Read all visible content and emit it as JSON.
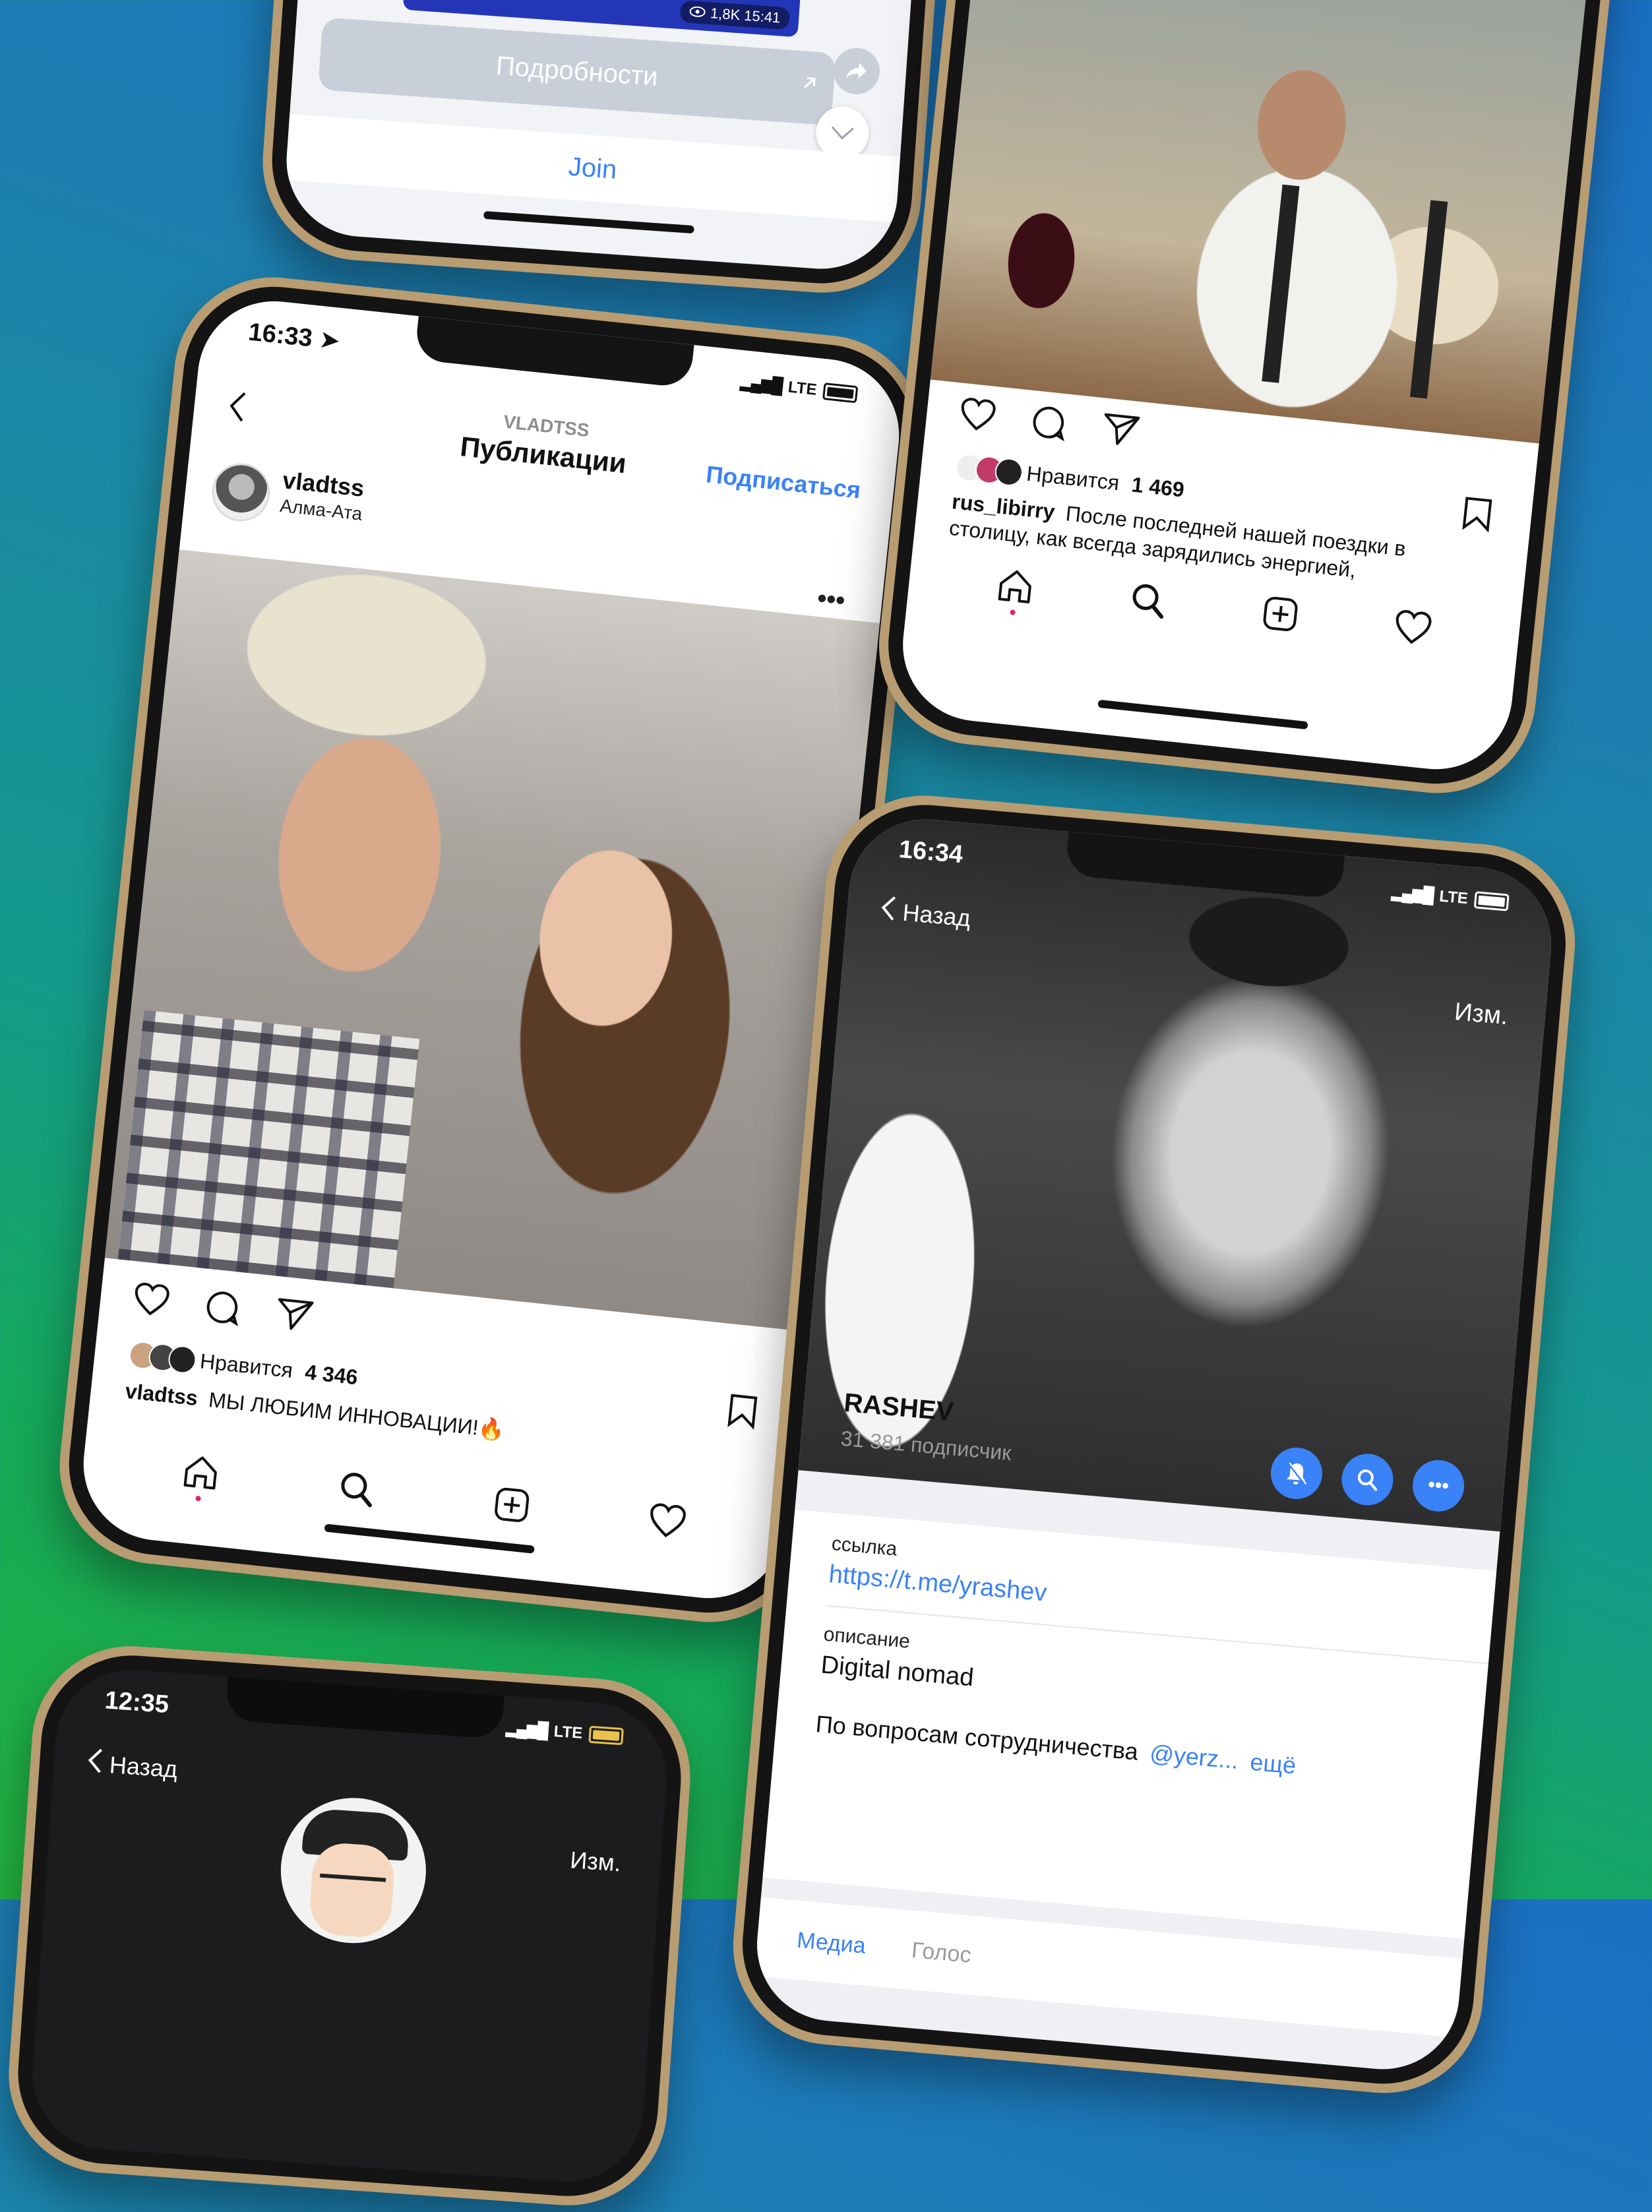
{
  "colors": {
    "accent_blue": "#3a82f7",
    "instagram_like_red": "#e0245e",
    "frame_gold": "#b89c72"
  },
  "phone_top_left": {
    "views_badge": "1,8K 15:41",
    "details_button": "Подробности",
    "join_label": "Join",
    "icons": [
      "eye-icon",
      "share-arrow-icon",
      "chevron-down-icon",
      "external-arrow-icon"
    ]
  },
  "phone_instagram_1": {
    "status": {
      "time": "16:33",
      "network": "LTE"
    },
    "header": {
      "username_upper": "VLADTSS",
      "title": "Публикации",
      "subscribe": "Подписаться"
    },
    "post": {
      "username": "vladtss",
      "location": "Алма-Ата",
      "likes_label": "Нравится",
      "likes_count": "4 346",
      "caption_user": "vladtss",
      "caption_text": "МЫ ЛЮБИМ ИННОВАЦИИ!🔥"
    },
    "icons": [
      "back-icon",
      "more-icon",
      "heart-icon",
      "comment-icon",
      "send-icon",
      "bookmark-icon",
      "home-icon",
      "search-icon",
      "add-icon",
      "activity-heart-icon"
    ]
  },
  "phone_instagram_2": {
    "post": {
      "likes_label": "Нравится",
      "likes_count": "1 469",
      "caption_user": "rus_libirry",
      "caption_text": "После последней нашей поездки в столицу, как всегда зарядились энергией,"
    },
    "icons": [
      "heart-icon",
      "comment-icon",
      "send-icon",
      "bookmark-icon",
      "home-icon",
      "search-icon",
      "add-icon",
      "activity-heart-icon"
    ]
  },
  "phone_telegram": {
    "status": {
      "time": "16:34",
      "network": "LTE"
    },
    "back_label": "Назад",
    "edit_label": "Изм.",
    "channel": {
      "name": "RASHEV",
      "subscribers": "31 381 подписчик"
    },
    "link_label": "ссылка",
    "link_value": "https://t.me/yrashev",
    "description_label": "описание",
    "description_value": "Digital nomad",
    "bio_text": "По вопросам сотрудничества",
    "bio_handle": "@yerz...",
    "bio_more": "ещё",
    "tabs": [
      "Медиа",
      "Голос"
    ],
    "icons": [
      "mute-bell-icon",
      "search-icon",
      "more-icon"
    ]
  },
  "phone_bottom_left": {
    "status": {
      "time": "12:35",
      "network": "LTE"
    },
    "back_label": "Назад",
    "edit_label": "Изм."
  }
}
